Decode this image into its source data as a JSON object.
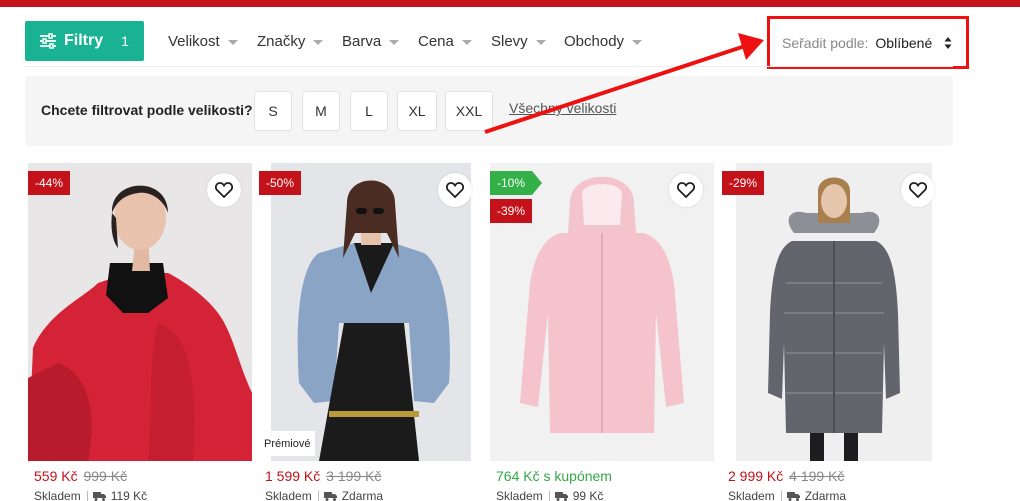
{
  "filter_button": {
    "label": "Filtry",
    "count": "1",
    "color": "#19b394"
  },
  "facets": [
    {
      "label": "Velikost"
    },
    {
      "label": "Značky"
    },
    {
      "label": "Barva"
    },
    {
      "label": "Cena"
    },
    {
      "label": "Slevy"
    },
    {
      "label": "Obchody"
    }
  ],
  "sort": {
    "label": "Seřadit podle:",
    "value": "Oblíbené",
    "highlight_color": "#ee1111"
  },
  "size_filter": {
    "question": "Chcete filtrovat podle velikosti?",
    "sizes": [
      "S",
      "M",
      "L",
      "XL",
      "XXL"
    ],
    "all_sizes_link": "Všechny velikosti"
  },
  "products": [
    {
      "badges": [
        "-44%"
      ],
      "price": "559 Kč",
      "old_price": "999 Kč",
      "stock": "Skladem",
      "shipping": "119 Kč"
    },
    {
      "badges": [
        "-50%"
      ],
      "premium_label": "Prémiové",
      "price": "1 599 Kč",
      "old_price": "3 199 Kč",
      "stock": "Skladem",
      "shipping": "Zdarma"
    },
    {
      "badges": [
        "-10%",
        "-39%"
      ],
      "coupon_price": "764 Kč s kupónem",
      "stock": "Skladem",
      "shipping": "99 Kč"
    },
    {
      "badges": [
        "-29%"
      ],
      "price": "2 999 Kč",
      "old_price": "4 199 Kč",
      "stock": "Skladem",
      "shipping": "Zdarma"
    }
  ],
  "colors": {
    "brand_red": "#c4121a",
    "discount_red": "#c4121a",
    "coupon_green": "#33b047"
  }
}
